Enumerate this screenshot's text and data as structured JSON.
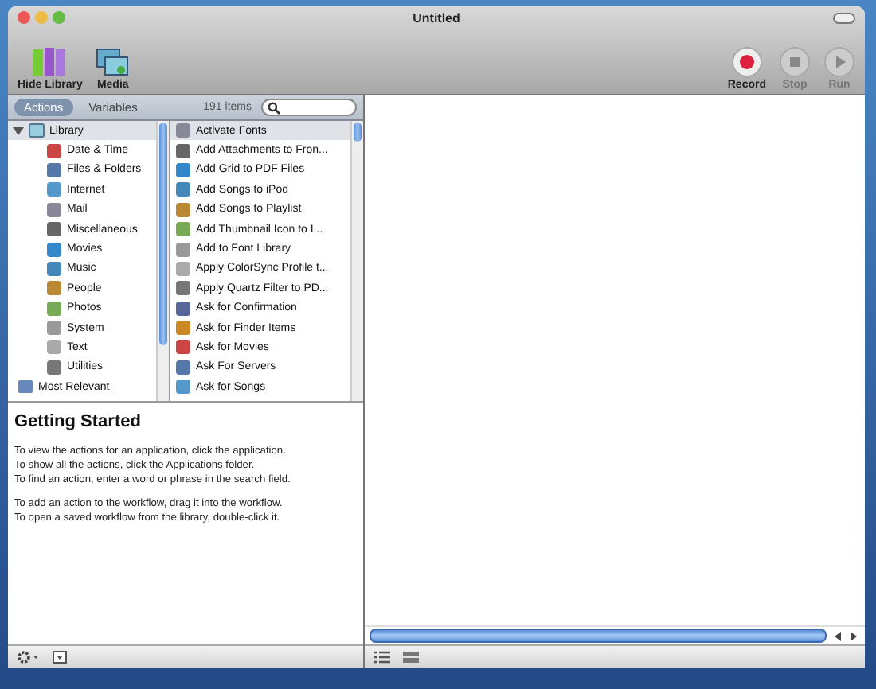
{
  "window": {
    "title": "Untitled"
  },
  "toolbar_left": [
    {
      "label": "Hide Library",
      "kind": "library"
    },
    {
      "label": "Media",
      "kind": "media"
    }
  ],
  "toolbar_right": [
    {
      "label": "Record",
      "kind": "record",
      "disabled": false
    },
    {
      "label": "Stop",
      "kind": "stop",
      "disabled": true
    },
    {
      "label": "Run",
      "kind": "run",
      "disabled": true
    }
  ],
  "tabs": [
    {
      "label": "Actions",
      "selected": true
    },
    {
      "label": "Variables",
      "selected": false
    }
  ],
  "item_count": "191 items",
  "library": {
    "label": "Library",
    "expanded": true,
    "selected": true,
    "children": [
      {
        "label": "Date & Time",
        "selected": false
      },
      {
        "label": "Files & Folders",
        "selected": false
      },
      {
        "label": "Internet",
        "selected": false
      },
      {
        "label": "Mail",
        "selected": false
      },
      {
        "label": "Miscellaneous",
        "selected": false
      },
      {
        "label": "Movies",
        "selected": false
      },
      {
        "label": "Music",
        "selected": false
      },
      {
        "label": "People",
        "selected": false
      },
      {
        "label": "Photos",
        "selected": false
      },
      {
        "label": "System",
        "selected": false
      },
      {
        "label": "Text",
        "selected": false
      },
      {
        "label": "Utilities",
        "selected": false
      }
    ]
  },
  "library_extra": [
    {
      "label": "Most Relevant",
      "selected": false
    }
  ],
  "actions": [
    {
      "label": "Activate Fonts",
      "selected": true
    },
    {
      "label": "Add Attachments to Fron...",
      "selected": false
    },
    {
      "label": "Add Grid to PDF Files",
      "selected": false
    },
    {
      "label": "Add Songs to iPod",
      "selected": false
    },
    {
      "label": "Add Songs to Playlist",
      "selected": false
    },
    {
      "label": "Add Thumbnail Icon to I...",
      "selected": false
    },
    {
      "label": "Add to Font Library",
      "selected": false
    },
    {
      "label": "Apply ColorSync Profile t...",
      "selected": false
    },
    {
      "label": "Apply Quartz Filter to PD...",
      "selected": false
    },
    {
      "label": "Ask for Confirmation",
      "selected": false
    },
    {
      "label": "Ask for Finder Items",
      "selected": false
    },
    {
      "label": "Ask for Movies",
      "selected": false
    },
    {
      "label": "Ask For Servers",
      "selected": false
    },
    {
      "label": "Ask for Songs",
      "selected": false
    }
  ],
  "description": {
    "title": "Getting Started",
    "paragraphs": [
      [
        "To view the actions for an application, click the application.",
        "To show all the actions, click the Applications folder.",
        "To find an action, enter a word or phrase in the search field."
      ],
      [
        "To add an action to the workflow, drag it into the workflow.",
        "To open a saved workflow from the library, double-click it."
      ]
    ]
  }
}
